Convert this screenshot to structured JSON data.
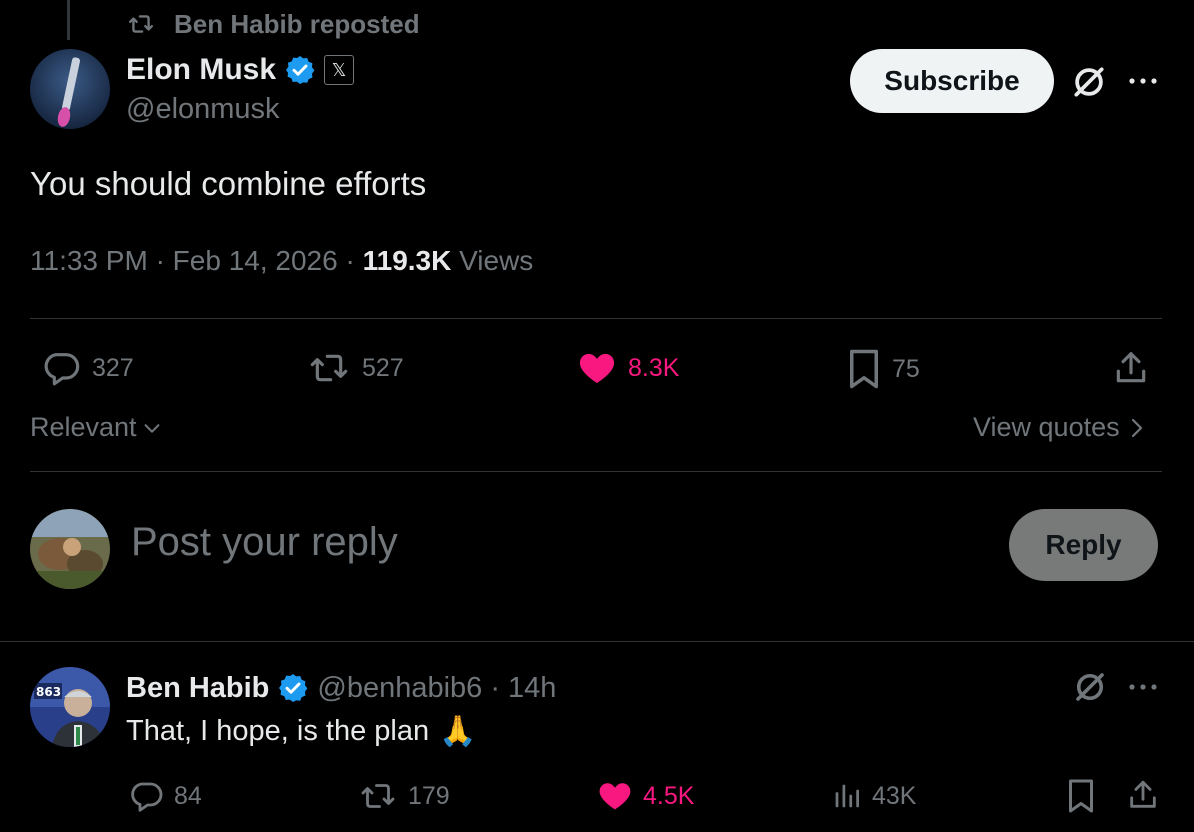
{
  "repost": {
    "label": "Ben Habib reposted"
  },
  "post": {
    "author_name": "Elon Musk",
    "author_handle": "@elonmusk",
    "affiliate_badge": "𝕏",
    "subscribe_label": "Subscribe",
    "text": "You should combine efforts",
    "time": "11:33 PM",
    "date": "Feb 14, 2026",
    "views_count": "119.3K",
    "views_label": "Views",
    "replies": "327",
    "reposts": "527",
    "likes": "8.3K",
    "bookmarks": "75"
  },
  "sort": {
    "label": "Relevant"
  },
  "quotes": {
    "label": "View quotes"
  },
  "composer": {
    "placeholder": "Post your reply",
    "button_label": "Reply"
  },
  "reply": {
    "author_name": "Ben Habib",
    "author_handle": "@benhabib6",
    "age": "14h",
    "text": "That, I hope, is the plan",
    "emoji": "🙏",
    "replies": "84",
    "reposts": "179",
    "likes": "4.5K",
    "views": "43K",
    "avatar_badge": "863"
  },
  "colors": {
    "background": "#000000",
    "text": "#e7e9ea",
    "muted": "#71767b",
    "like": "#f91880",
    "verified": "#1d9bf0",
    "divider": "#2f3336"
  }
}
